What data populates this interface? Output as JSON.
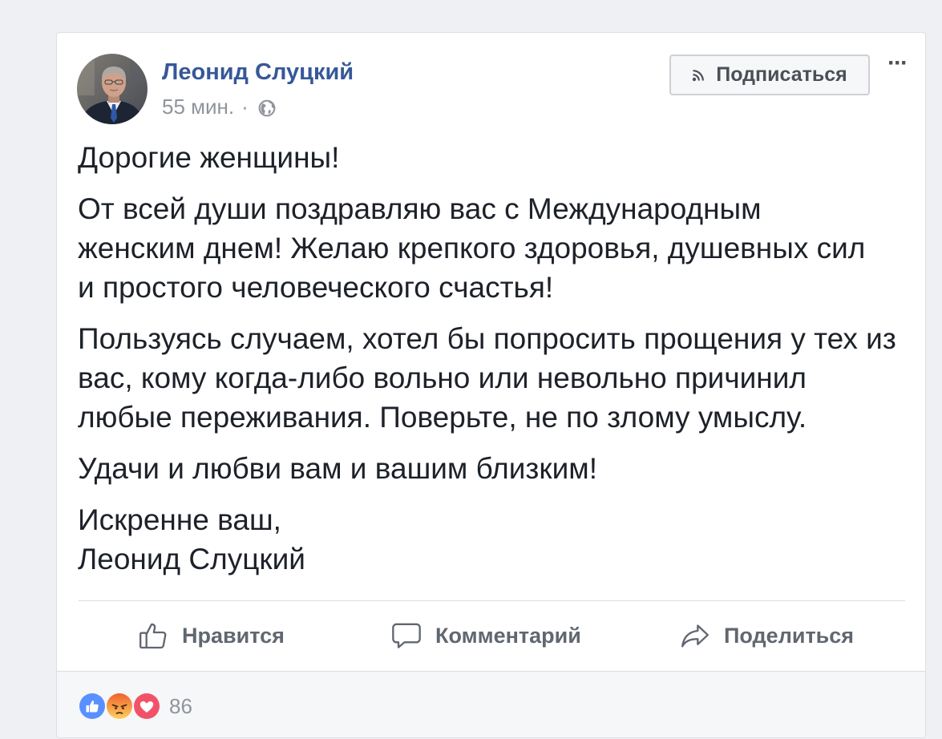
{
  "post": {
    "author": "Леонид Слуцкий",
    "timestamp": "55 мин.",
    "separator": "·",
    "privacy_icon": "globe-icon",
    "follow": {
      "label": "Подписаться",
      "icon": "rss-icon"
    },
    "more": "···",
    "paragraphs": [
      {
        "lines": [
          "Дорогие женщины!"
        ]
      },
      {
        "lines": [
          "От всей души поздравляю вас с Международным",
          "женским днем! Желаю крепкого здоровья, душевных сил",
          "и простого человеческого счастья!"
        ]
      },
      {
        "lines": [
          "Пользуясь случаем, хотел бы попросить прощения у тех из",
          "вас, кому когда-либо вольно или невольно причинил",
          "любые переживания. Поверьте, не по злому умыслу."
        ]
      },
      {
        "lines": [
          "Удачи и любви вам и вашим близким!"
        ]
      },
      {
        "lines": [
          "Искренне ваш,",
          "Леонид Слуцкий"
        ]
      }
    ]
  },
  "actions": [
    {
      "label": "Нравится",
      "icon": "thumbs-up-icon"
    },
    {
      "label": "Комментарий",
      "icon": "comment-icon"
    },
    {
      "label": "Поделиться",
      "icon": "share-icon"
    }
  ],
  "reactions": {
    "types": [
      "like-icon",
      "angry-icon",
      "love-icon"
    ],
    "count": "86"
  },
  "colors": {
    "page_bg": "#eef0f3",
    "author": "#365899",
    "text": "#1d2129",
    "meta": "#90949c",
    "action": "#606770",
    "like": "#5890ff",
    "love": "#f25268",
    "angry": "#f07a34"
  }
}
